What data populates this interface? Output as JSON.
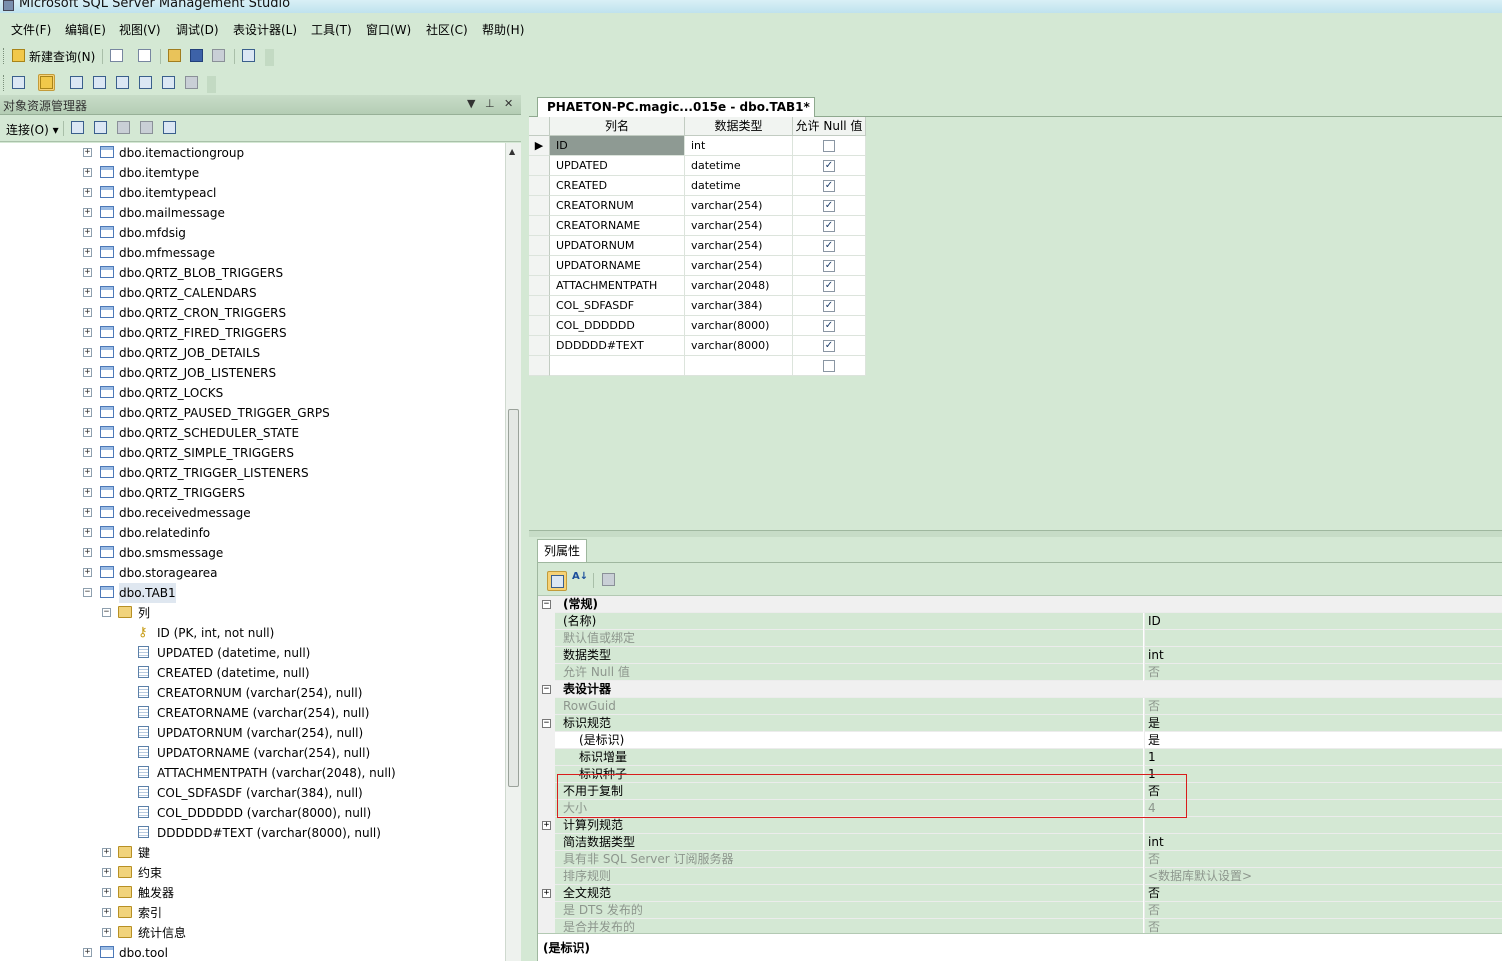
{
  "window": {
    "title": "Microsoft SQL Server Management Studio"
  },
  "menu": [
    "文件(F)",
    "编辑(E)",
    "视图(V)",
    "调试(D)",
    "表设计器(L)",
    "工具(T)",
    "窗口(W)",
    "社区(C)",
    "帮助(H)"
  ],
  "toolbar": {
    "new_query": "新建查询(N)"
  },
  "object_explorer": {
    "title": "对象资源管理器",
    "connect": "连接(O)",
    "pin_glyph": "▼ ⊥ ✕",
    "tree": [
      {
        "label": "dbo.itemactiongroup",
        "level": 1,
        "icon": "table-icon",
        "exp": "+"
      },
      {
        "label": "dbo.itemtype",
        "level": 1,
        "icon": "table-icon",
        "exp": "+"
      },
      {
        "label": "dbo.itemtypeacl",
        "level": 1,
        "icon": "table-icon",
        "exp": "+"
      },
      {
        "label": "dbo.mailmessage",
        "level": 1,
        "icon": "table-icon",
        "exp": "+"
      },
      {
        "label": "dbo.mfdsig",
        "level": 1,
        "icon": "table-icon",
        "exp": "+"
      },
      {
        "label": "dbo.mfmessage",
        "level": 1,
        "icon": "table-icon",
        "exp": "+"
      },
      {
        "label": "dbo.QRTZ_BLOB_TRIGGERS",
        "level": 1,
        "icon": "table-icon",
        "exp": "+"
      },
      {
        "label": "dbo.QRTZ_CALENDARS",
        "level": 1,
        "icon": "table-icon",
        "exp": "+"
      },
      {
        "label": "dbo.QRTZ_CRON_TRIGGERS",
        "level": 1,
        "icon": "table-icon",
        "exp": "+"
      },
      {
        "label": "dbo.QRTZ_FIRED_TRIGGERS",
        "level": 1,
        "icon": "table-icon",
        "exp": "+"
      },
      {
        "label": "dbo.QRTZ_JOB_DETAILS",
        "level": 1,
        "icon": "table-icon",
        "exp": "+"
      },
      {
        "label": "dbo.QRTZ_JOB_LISTENERS",
        "level": 1,
        "icon": "table-icon",
        "exp": "+"
      },
      {
        "label": "dbo.QRTZ_LOCKS",
        "level": 1,
        "icon": "table-icon",
        "exp": "+"
      },
      {
        "label": "dbo.QRTZ_PAUSED_TRIGGER_GRPS",
        "level": 1,
        "icon": "table-icon",
        "exp": "+"
      },
      {
        "label": "dbo.QRTZ_SCHEDULER_STATE",
        "level": 1,
        "icon": "table-icon",
        "exp": "+"
      },
      {
        "label": "dbo.QRTZ_SIMPLE_TRIGGERS",
        "level": 1,
        "icon": "table-icon",
        "exp": "+"
      },
      {
        "label": "dbo.QRTZ_TRIGGER_LISTENERS",
        "level": 1,
        "icon": "table-icon",
        "exp": "+"
      },
      {
        "label": "dbo.QRTZ_TRIGGERS",
        "level": 1,
        "icon": "table-icon",
        "exp": "+"
      },
      {
        "label": "dbo.receivedmessage",
        "level": 1,
        "icon": "table-icon",
        "exp": "+"
      },
      {
        "label": "dbo.relatedinfo",
        "level": 1,
        "icon": "table-icon",
        "exp": "+"
      },
      {
        "label": "dbo.smsmessage",
        "level": 1,
        "icon": "table-icon",
        "exp": "+"
      },
      {
        "label": "dbo.storagearea",
        "level": 1,
        "icon": "table-icon",
        "exp": "+"
      },
      {
        "label": "dbo.TAB1",
        "level": 1,
        "icon": "table-icon",
        "exp": "−",
        "selected": true
      },
      {
        "label": "列",
        "level": 2,
        "icon": "folder-icon",
        "exp": "−"
      },
      {
        "label": "ID (PK, int, not null)",
        "level": 3,
        "icon": "key-icon",
        "exp": ""
      },
      {
        "label": "UPDATED (datetime, null)",
        "level": 3,
        "icon": "column-icon",
        "exp": ""
      },
      {
        "label": "CREATED (datetime, null)",
        "level": 3,
        "icon": "column-icon",
        "exp": ""
      },
      {
        "label": "CREATORNUM (varchar(254), null)",
        "level": 3,
        "icon": "column-icon",
        "exp": ""
      },
      {
        "label": "CREATORNAME (varchar(254), null)",
        "level": 3,
        "icon": "column-icon",
        "exp": ""
      },
      {
        "label": "UPDATORNUM (varchar(254), null)",
        "level": 3,
        "icon": "column-icon",
        "exp": ""
      },
      {
        "label": "UPDATORNAME (varchar(254), null)",
        "level": 3,
        "icon": "column-icon",
        "exp": ""
      },
      {
        "label": "ATTACHMENTPATH (varchar(2048), null)",
        "level": 3,
        "icon": "column-icon",
        "exp": ""
      },
      {
        "label": "COL_SDFASDF (varchar(384), null)",
        "level": 3,
        "icon": "column-icon",
        "exp": ""
      },
      {
        "label": "COL_DDDDDD (varchar(8000), null)",
        "level": 3,
        "icon": "column-icon",
        "exp": ""
      },
      {
        "label": "DDDDDD#TEXT (varchar(8000), null)",
        "level": 3,
        "icon": "column-icon",
        "exp": ""
      },
      {
        "label": "键",
        "level": 2,
        "icon": "folder-icon",
        "exp": "+"
      },
      {
        "label": "约束",
        "level": 2,
        "icon": "folder-icon",
        "exp": "+"
      },
      {
        "label": "触发器",
        "level": 2,
        "icon": "folder-icon",
        "exp": "+"
      },
      {
        "label": "索引",
        "level": 2,
        "icon": "folder-icon",
        "exp": "+"
      },
      {
        "label": "统计信息",
        "level": 2,
        "icon": "folder-icon",
        "exp": "+"
      },
      {
        "label": "dbo.tool",
        "level": 1,
        "icon": "table-icon",
        "exp": "+"
      }
    ]
  },
  "designer": {
    "tab": "PHAETON-PC.magic...015e - dbo.TAB1*",
    "headers": [
      "列名",
      "数据类型",
      "允许 Null 值"
    ],
    "rows": [
      {
        "name": "ID",
        "type": "int",
        "null": false,
        "key": true
      },
      {
        "name": "UPDATED",
        "type": "datetime",
        "null": true
      },
      {
        "name": "CREATED",
        "type": "datetime",
        "null": true
      },
      {
        "name": "CREATORNUM",
        "type": "varchar(254)",
        "null": true
      },
      {
        "name": "CREATORNAME",
        "type": "varchar(254)",
        "null": true
      },
      {
        "name": "UPDATORNUM",
        "type": "varchar(254)",
        "null": true
      },
      {
        "name": "UPDATORNAME",
        "type": "varchar(254)",
        "null": true
      },
      {
        "name": "ATTACHMENTPATH",
        "type": "varchar(2048)",
        "null": true
      },
      {
        "name": "COL_SDFASDF",
        "type": "varchar(384)",
        "null": true
      },
      {
        "name": "COL_DDDDDD",
        "type": "varchar(8000)",
        "null": true
      },
      {
        "name": "DDDDDD#TEXT",
        "type": "varchar(8000)",
        "null": true
      },
      {
        "name": "",
        "type": "",
        "null": false
      }
    ]
  },
  "properties": {
    "tab": "列属性",
    "rows": [
      {
        "kind": "cat",
        "name": "(常规)",
        "exp": "−"
      },
      {
        "name": "(名称)",
        "value": "ID"
      },
      {
        "name": "默认值或绑定",
        "value": "",
        "gray": true
      },
      {
        "name": "数据类型",
        "value": "int"
      },
      {
        "name": "允许 Null 值",
        "value": "否",
        "gray": true
      },
      {
        "kind": "cat",
        "name": "表设计器",
        "exp": "−"
      },
      {
        "name": "RowGuid",
        "value": "否",
        "gray": true
      },
      {
        "name": "标识规范",
        "value": "是",
        "exp": "−"
      },
      {
        "name": "(是标识)",
        "value": "是",
        "sub": true,
        "highlight": true
      },
      {
        "name": "标识增量",
        "value": "1",
        "sub": true
      },
      {
        "name": "标识种子",
        "value": "1",
        "sub": true
      },
      {
        "name": "不用于复制",
        "value": "否"
      },
      {
        "name": "大小",
        "value": "4",
        "gray": true
      },
      {
        "name": "计算列规范",
        "value": "",
        "exp": "+"
      },
      {
        "name": "简洁数据类型",
        "value": "int"
      },
      {
        "name": "具有非 SQL Server 订阅服务器",
        "value": "否",
        "gray": true
      },
      {
        "name": "排序规则",
        "value": "<数据库默认设置>",
        "gray": true
      },
      {
        "name": "全文规范",
        "value": "否",
        "exp": "+"
      },
      {
        "name": "是 DTS 发布的",
        "value": "否",
        "gray": true
      },
      {
        "name": "是合并发布的",
        "value": "否",
        "gray": true
      }
    ],
    "description": "(是标识)"
  }
}
